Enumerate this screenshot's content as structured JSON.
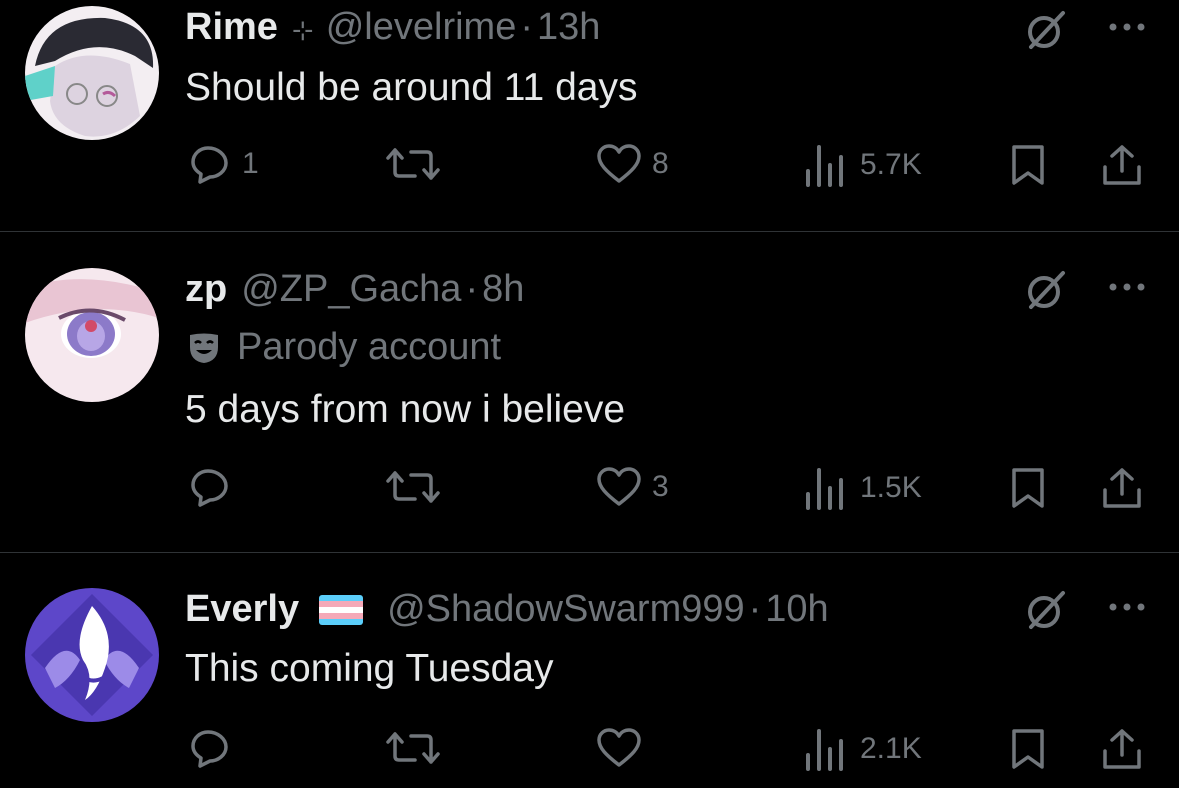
{
  "tweets": [
    {
      "name": "Rime",
      "name_badge": "⊹",
      "handle": "@levelrime",
      "separator": "·",
      "time": "13h",
      "label": "",
      "text": "Should be around 11 days",
      "reply_count": "1",
      "like_count": "8",
      "view_count": "5.7K"
    },
    {
      "name": "zp",
      "name_badge": "",
      "handle": "@ZP_Gacha",
      "separator": "·",
      "time": "8h",
      "label": "Parody account",
      "text": "5 days from now i believe",
      "reply_count": "",
      "like_count": "3",
      "view_count": "1.5K"
    },
    {
      "name": "Everly",
      "name_badge": "trans-flag",
      "handle": "@ShadowSwarm999",
      "separator": "·",
      "time": "10h",
      "label": "",
      "text": "This coming Tuesday",
      "reply_count": "",
      "like_count": "",
      "view_count": "2.1K"
    }
  ],
  "colors": {
    "background": "#000000",
    "text": "#e7e9ea",
    "muted": "#71767b",
    "divider": "#2f3336",
    "flag_blue": "#5bcefa",
    "flag_pink": "#f5a9b8",
    "flag_white": "#ffffff"
  },
  "icons": [
    "grok-icon",
    "more-icon",
    "reply-icon",
    "retweet-icon",
    "like-icon",
    "views-icon",
    "bookmark-icon",
    "share-icon",
    "parody-mask-icon"
  ]
}
